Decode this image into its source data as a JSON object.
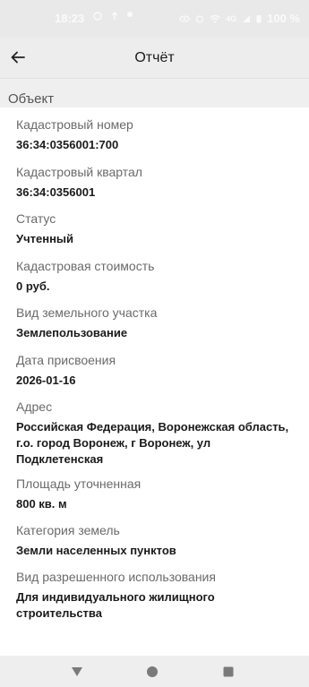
{
  "status_bar": {
    "time": "18:23",
    "battery": "100 %",
    "network": "4G"
  },
  "app_bar": {
    "title": "Отчёт"
  },
  "section": {
    "title": "Объект"
  },
  "fields": [
    {
      "label": "Кадастровый номер",
      "value": "36:34:0356001:700"
    },
    {
      "label": "Кадастровый квартал",
      "value": "36:34:0356001"
    },
    {
      "label": "Статус",
      "value": "Учтенный"
    },
    {
      "label": "Кадастровая стоимость",
      "value": "0 руб."
    },
    {
      "label": "Вид земельного участка",
      "value": "Землепользование"
    },
    {
      "label": "Дата присвоения",
      "value": "2026-01-16"
    },
    {
      "label": "Адрес",
      "value": "Российская Федерация, Воронежская область, г.о. город Воронеж, г Воронеж, ул Подклетенская"
    },
    {
      "label": "Площадь уточненная",
      "value": "800 кв. м"
    },
    {
      "label": "Категория земель",
      "value": "Земли населенных пунктов"
    },
    {
      "label": "Вид разрешенного использования",
      "value": "Для индивидуального жилищного строительства"
    }
  ],
  "icons": {
    "back": "arrow-left-icon",
    "nav_back": "triangle-back-icon",
    "nav_home": "circle-home-icon",
    "nav_recents": "square-recents-icon"
  },
  "colors": {
    "app_bar_bg": "#ededed",
    "label": "#6a6a6a",
    "value": "#1a1a1a"
  }
}
